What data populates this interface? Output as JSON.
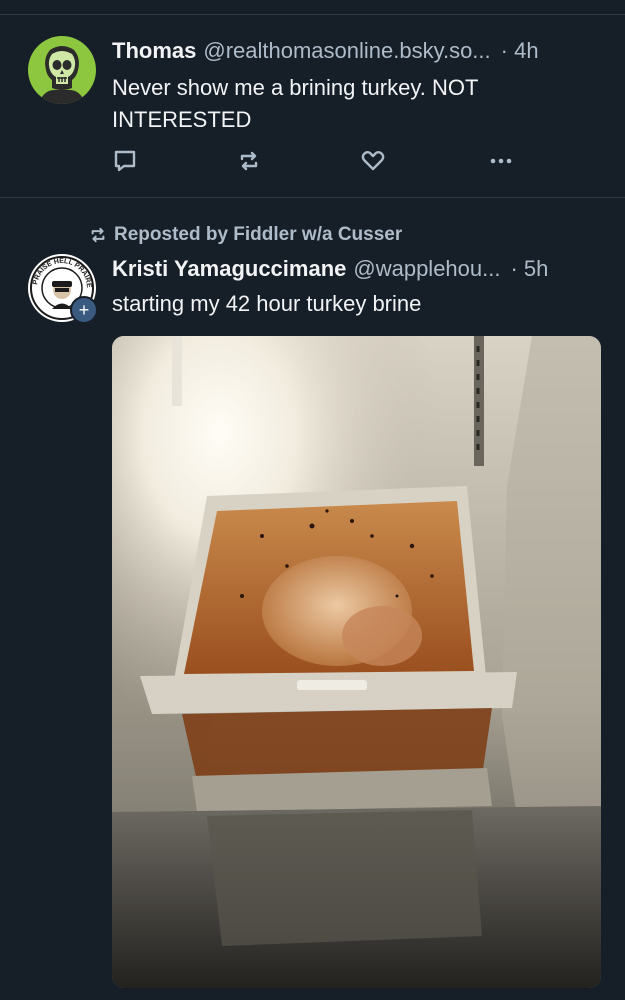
{
  "posts": [
    {
      "author_name": "Thomas",
      "author_handle": "@realthomasonline.bsky.so...",
      "time": "· 4h",
      "text": "Never show me a brining turkey. NOT INTERESTED",
      "avatar": "skull-avatar"
    },
    {
      "repost_label": "Reposted by Fiddler w/a Cusser",
      "author_name": "Kristi Yamaguccimane",
      "author_handle": "@wapplehou...",
      "time": "· 5h",
      "text": "starting my 42 hour turkey brine",
      "avatar": "badge-avatar",
      "avatar_badge_text": "PRAISE HELL PRAIRE DALE",
      "image": "turkey brining in refrigerator crisper drawer",
      "follow_badge": "+"
    }
  ],
  "icons": {
    "reply": "speech-bubble-icon",
    "repost": "repost-arrows-icon",
    "like": "heart-icon",
    "more": "ellipsis-icon"
  },
  "colors": {
    "background": "#161e27",
    "divider": "#2e3a47",
    "primary_text": "#f1f3f5",
    "secondary_text": "#aebbc9",
    "icon": "#aebbc9"
  }
}
